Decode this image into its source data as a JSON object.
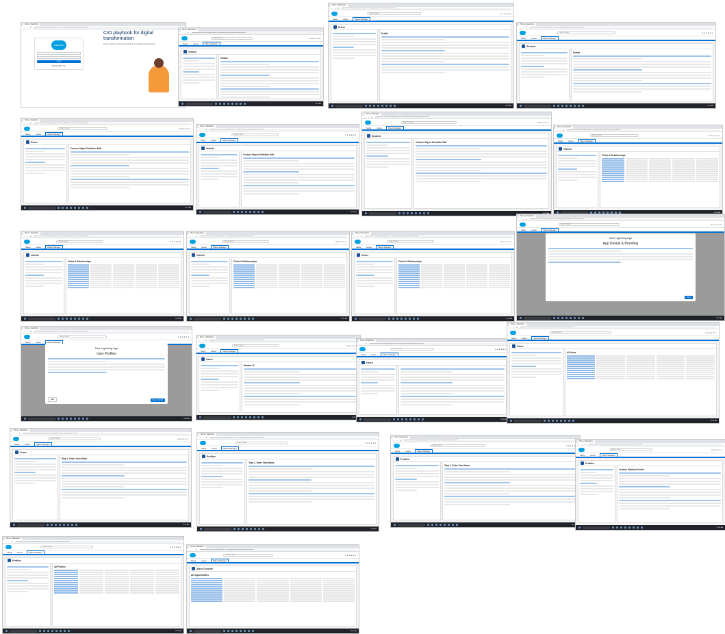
{
  "chrome": {
    "tab_label": "Home | Salesforce",
    "url": "orgfarm-dev-ed.develop.lightning.force.com/lightning/setup/ObjectManager/home",
    "nav_back": "←",
    "nav_forward": "→",
    "nav_reload": "C"
  },
  "salesforce": {
    "search_placeholder": "Search Setup",
    "setup_label": "Setup",
    "home_tab": "Home",
    "object_manager_tab": "Object Manager"
  },
  "shots": [
    {
      "kind": "login",
      "promo_title": "CIO playbook for digital transformation",
      "promo_sub": "Expert Insights on how to fuel growth by leveraging your data and AI",
      "logo": "salesforce",
      "username_value": "",
      "login_button": "Log In",
      "remember": "Remember me"
    },
    {
      "kind": "object",
      "title": "Vehicle",
      "breadcrumb": "SETUP > OBJECT MANAGER",
      "section": "Details"
    },
    {
      "kind": "object",
      "title": "Driver",
      "breadcrumb": "SETUP > OBJECT MANAGER",
      "section": "Details"
    },
    {
      "kind": "object",
      "title": "Student",
      "breadcrumb": "SETUP > OBJECT MANAGER",
      "section": "Details"
    },
    {
      "kind": "form",
      "title": "Driver",
      "section": "Custom Object Definition Edit"
    },
    {
      "kind": "form",
      "title": "Vehicle",
      "section": "Custom Object Definition Edit"
    },
    {
      "kind": "form",
      "title": "Student",
      "section": "Custom Object Definition Edit"
    },
    {
      "kind": "fields",
      "title": "Vehicle",
      "section": "Fields & Relationships"
    },
    {
      "kind": "fields",
      "title": "Vehicle",
      "section": "Fields & Relationships"
    },
    {
      "kind": "fields",
      "title": "Vehicle",
      "section": "Fields & Relationships"
    },
    {
      "kind": "fields",
      "title": "Driver",
      "section": "Fields & Relationships"
    },
    {
      "kind": "modal",
      "title": "New Lightning App",
      "subtitle": "App Details & Branding",
      "next": "Next",
      "back": ""
    },
    {
      "kind": "modal",
      "title": "New Lightning App",
      "subtitle": "User Profiles",
      "next": "Save & Finish",
      "back": "Back"
    },
    {
      "kind": "userform",
      "title": "Users",
      "section": "Student 11"
    },
    {
      "kind": "userform",
      "title": "Users",
      "section": ""
    },
    {
      "kind": "users",
      "title": "Users",
      "section": "All Users"
    },
    {
      "kind": "userform",
      "title": "Users",
      "section": "Step 1. Enter View Name"
    },
    {
      "kind": "userform",
      "title": "Profiles",
      "section": "Step 1. Enter View Name"
    },
    {
      "kind": "userform",
      "title": "Profiles",
      "section": "Step 1. Enter View Name"
    },
    {
      "kind": "userform",
      "title": "Profiles",
      "section": "Custom Platform Profile"
    },
    {
      "kind": "users",
      "title": "Profiles",
      "section": "All Profiles"
    },
    {
      "kind": "list",
      "title": "Sales Console",
      "section": "All Opportunities"
    }
  ],
  "taskbar": {
    "time": "10:24 AM",
    "search": "Type here to search"
  }
}
